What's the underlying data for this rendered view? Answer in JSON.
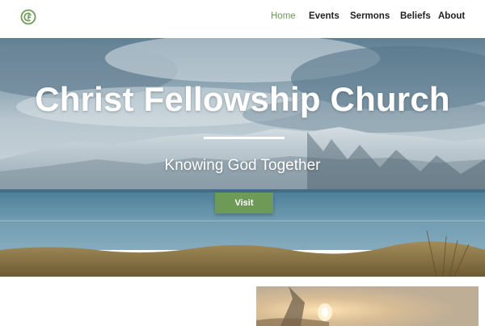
{
  "nav": {
    "items": [
      {
        "label": "Home",
        "active": true
      },
      {
        "label": "Events",
        "active": false
      },
      {
        "label": "Sermons",
        "active": false
      },
      {
        "label": "Beliefs",
        "active": false
      },
      {
        "label": "About",
        "active": false
      }
    ]
  },
  "hero": {
    "title": "Christ Fellowship Church",
    "subtitle": "Knowing God Together",
    "cta_label": "Visit"
  },
  "colors": {
    "accent": "#6e9a57",
    "header_bg": "#ffffff",
    "nav_text": "#222222"
  },
  "icons": {
    "logo": "cf-logo-icon"
  }
}
